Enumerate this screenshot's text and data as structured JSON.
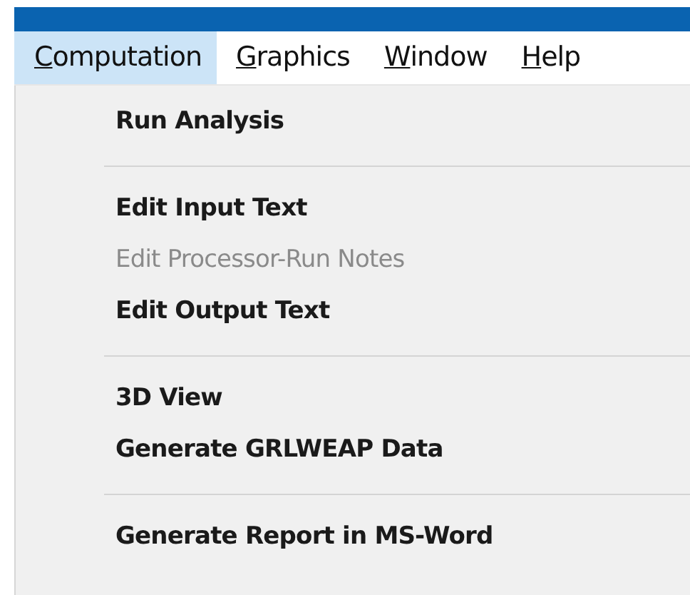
{
  "menu_bar": [
    {
      "accel": "C",
      "rest": "omputation",
      "selected": true
    },
    {
      "accel": "G",
      "rest": "raphics",
      "selected": false
    },
    {
      "accel": "W",
      "rest": "indow",
      "selected": false
    },
    {
      "accel": "H",
      "rest": "elp",
      "selected": false
    }
  ],
  "dropdown": [
    {
      "kind": "item",
      "label": "Run Analysis",
      "disabled": false
    },
    {
      "kind": "separator"
    },
    {
      "kind": "item",
      "label": "Edit Input Text",
      "disabled": false
    },
    {
      "kind": "item",
      "label": "Edit Processor-Run Notes",
      "disabled": true
    },
    {
      "kind": "item",
      "label": "Edit Output Text",
      "disabled": false
    },
    {
      "kind": "separator"
    },
    {
      "kind": "item",
      "label": "3D View",
      "disabled": false
    },
    {
      "kind": "item",
      "label": "Generate GRLWEAP Data",
      "disabled": false
    },
    {
      "kind": "separator"
    },
    {
      "kind": "item",
      "label": "Generate Report in MS-Word",
      "disabled": false
    }
  ]
}
